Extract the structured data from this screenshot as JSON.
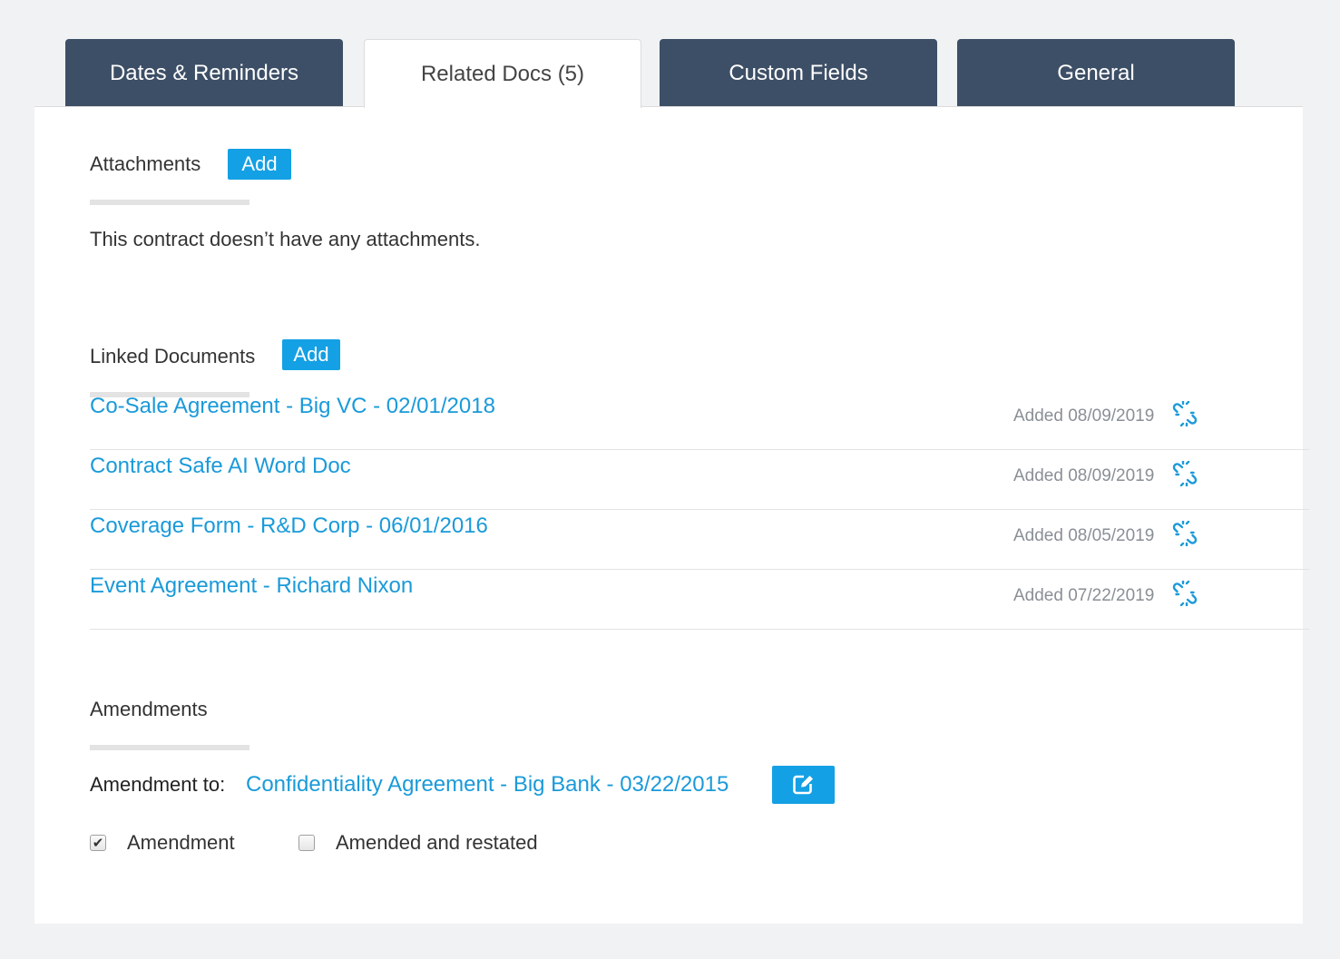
{
  "tabs": [
    {
      "label": "Dates & Reminders",
      "active": false
    },
    {
      "label": "Related Docs (5)",
      "active": true
    },
    {
      "label": "Custom Fields",
      "active": false
    },
    {
      "label": "General",
      "active": false
    }
  ],
  "attachments": {
    "title": "Attachments",
    "add_label": "Add",
    "empty_message": "This contract doesn’t have any attachments."
  },
  "linked_documents": {
    "title": "Linked Documents",
    "add_label": "Add",
    "items": [
      {
        "name": "Co-Sale Agreement - Big VC - 02/01/2018",
        "added": "Added 08/09/2019",
        "icon": "unlink-icon"
      },
      {
        "name": "Contract Safe AI Word Doc",
        "added": "Added 08/09/2019",
        "icon": "unlink-icon"
      },
      {
        "name": "Coverage Form - R&D Corp - 06/01/2016",
        "added": "Added 08/05/2019",
        "icon": "unlink-icon"
      },
      {
        "name": "Event Agreement - Richard Nixon",
        "added": "Added 07/22/2019",
        "icon": "unlink-icon"
      }
    ]
  },
  "amendments": {
    "title": "Amendments",
    "amendment_to_label": "Amendment to:",
    "amendment_to_link": "Confidentiality Agreement - Big Bank - 03/22/2015",
    "edit_icon": "edit-icon",
    "checkboxes": [
      {
        "label": "Amendment",
        "checked": true
      },
      {
        "label": "Amended and restated",
        "checked": false
      }
    ]
  },
  "colors": {
    "tab_dark": "#3d4f66",
    "accent": "#14a0e4",
    "link": "#1a9ad9",
    "background": "#f1f2f4"
  }
}
